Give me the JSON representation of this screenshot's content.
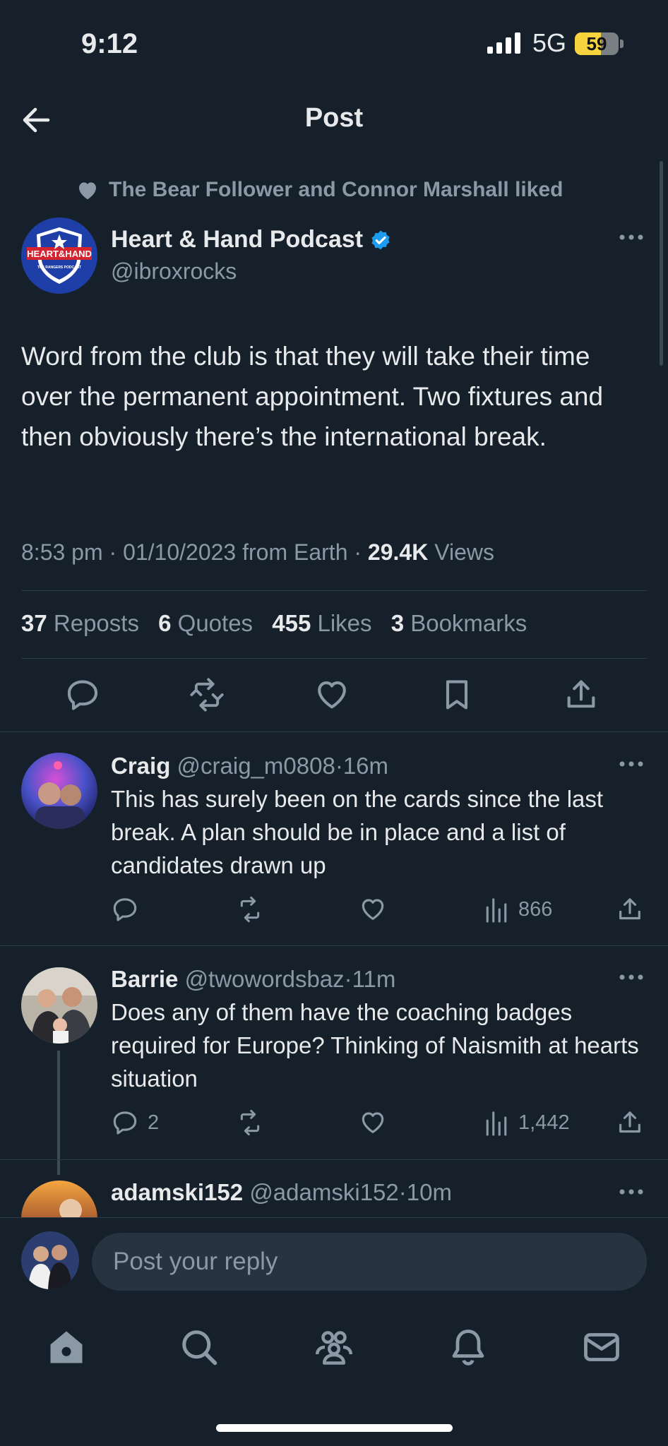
{
  "status_bar": {
    "time": "9:12",
    "network": "5G",
    "battery": "59",
    "battery_level": 0.59
  },
  "header": {
    "title": "Post",
    "back_icon": "arrow-left-icon"
  },
  "liked_by": {
    "text": "The Bear Follower and Connor Marshall liked",
    "icon": "heart-icon"
  },
  "main_post": {
    "author_name": "Heart & Hand Podcast",
    "handle": "@ibroxrocks",
    "verified": true,
    "avatar_text": "HEART&HAND",
    "avatar_subtext": "THE RANGERS PODCAST",
    "text": "Word from the club is that they will take their time over the permanent appointment. Two fixtures and then obviously there’s the international break.",
    "time": "8:53 pm",
    "date": "01/10/2023",
    "source": "from Earth",
    "views_count": "29.4K",
    "views_label": "Views",
    "stats": {
      "reposts_count": "37",
      "reposts_label": "Reposts",
      "quotes_count": "6",
      "quotes_label": "Quotes",
      "likes_count": "455",
      "likes_label": "Likes",
      "bookmarks_count": "3",
      "bookmarks_label": "Bookmarks"
    }
  },
  "replies": [
    {
      "name": "Craig",
      "handle": "@craig_m0808",
      "time": "16m",
      "text": "This has surely been on the cards since the last break. A plan should be in place and a list of candidates drawn up",
      "reply_count": "",
      "views": "866"
    },
    {
      "name": "Barrie",
      "handle": "@twowordsbaz",
      "time": "11m",
      "text": "Does any of them have the coaching badges required for Europe? Thinking of Naismith at hearts situation",
      "reply_count": "2",
      "views": "1,442"
    },
    {
      "name": "adamski152",
      "handle": "@adamski152",
      "time": "10m"
    }
  ],
  "composer": {
    "placeholder": "Post your reply"
  },
  "tab_bar": [
    "home-icon",
    "search-icon",
    "communities-icon",
    "notifications-icon",
    "messages-icon"
  ],
  "colors": {
    "background": "#15202b",
    "text": "#e7e9ea",
    "muted": "#8b98a5",
    "verified": "#1d9bf0",
    "battery": "#f7d33e"
  }
}
